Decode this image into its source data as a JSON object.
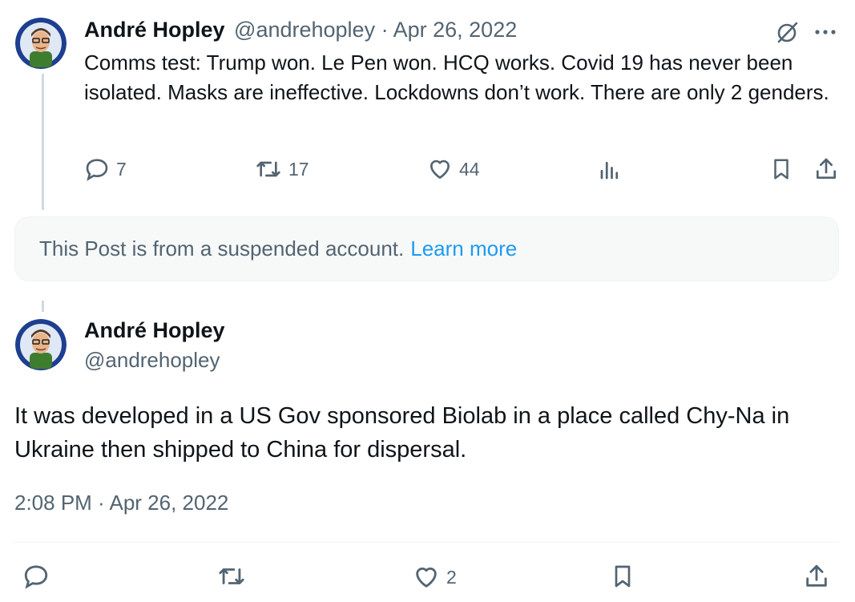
{
  "parent_tweet": {
    "author_name": "André Hopley",
    "author_handle": "@andrehopley",
    "separator": "·",
    "date": "Apr 26, 2022",
    "text": "Comms test: Trump won. Le Pen won. HCQ works. Covid 19 has never been isolated. Masks are ineffective. Lockdowns don’t work. There are only 2 genders.",
    "reply_count": "7",
    "repost_count": "17",
    "like_count": "44"
  },
  "suspended_notice": {
    "text": "This Post is from a suspended account.",
    "link": "Learn more"
  },
  "main_tweet": {
    "author_name": "André Hopley",
    "author_handle": "@andrehopley",
    "text": "It was developed in a US Gov sponsored Biolab in a place called Chy-Na in Ukraine then shipped to China for dispersal.",
    "timestamp": "2:08 PM · Apr 26, 2022",
    "like_count": "2"
  },
  "colors": {
    "link": "#1d9bf0",
    "muted": "#536471",
    "notice_bg": "#f7f9f9",
    "divider": "#eff3f4"
  },
  "icons": [
    "grok-icon",
    "more-icon",
    "reply-icon",
    "repost-icon",
    "like-icon",
    "views-icon",
    "bookmark-icon",
    "share-icon"
  ]
}
